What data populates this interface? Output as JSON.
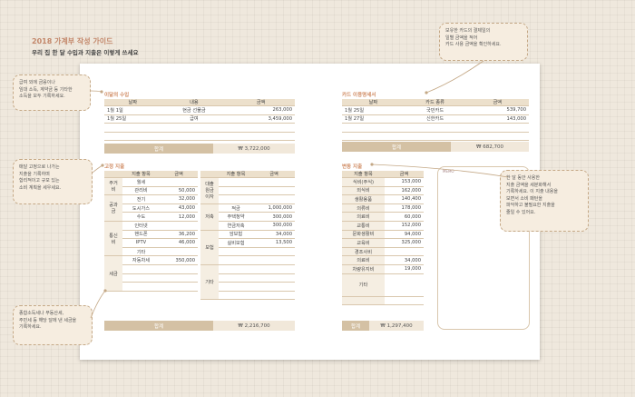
{
  "header": {
    "title": "2018 가계부 작성 가이드",
    "subtitle": "우리 집 한 달 수입과 지출은 이렇게 쓰세요"
  },
  "income": {
    "title": "이달의 수입",
    "headers": [
      "날짜",
      "내용",
      "금액"
    ],
    "rows": [
      {
        "date": "1월 1일",
        "desc": "현금 선물금",
        "amount": "263,000"
      },
      {
        "date": "1월 25일",
        "desc": "급여",
        "amount": "3,459,000"
      }
    ],
    "total_label": "합계",
    "total": "₩ 3,722,000"
  },
  "card": {
    "title": "카드 이용명세서",
    "headers": [
      "날짜",
      "카드 종류",
      "금액"
    ],
    "rows": [
      {
        "date": "1월 25일",
        "desc": "국민카드",
        "amount": "539,700"
      },
      {
        "date": "1월 27일",
        "desc": "신한카드",
        "amount": "143,000"
      }
    ],
    "total_label": "합계",
    "total": "₩ 682,700"
  },
  "fixed": {
    "title": "고정 지출",
    "headers": [
      "지출 항목",
      "금액",
      "지출 항목",
      "금액"
    ],
    "left_groups": [
      "주거비",
      "공과금",
      "통신비",
      "세금"
    ],
    "left_rows": [
      {
        "item": "월세",
        "amount": ""
      },
      {
        "item": "관리비",
        "amount": "50,000"
      },
      {
        "item": "전기",
        "amount": "32,000"
      },
      {
        "item": "도시가스",
        "amount": "43,000"
      },
      {
        "item": "수도",
        "amount": "12,000"
      },
      {
        "item": "인터넷",
        "amount": ""
      },
      {
        "item": "핸드폰",
        "amount": "36,200"
      },
      {
        "item": "IPTV",
        "amount": "46,000"
      },
      {
        "item": "기타",
        "amount": ""
      },
      {
        "item": "자동차세",
        "amount": "350,000"
      }
    ],
    "right_groups": [
      "대출원금 이자",
      "저축",
      "보험",
      "기타"
    ],
    "right_rows": [
      {
        "item": "",
        "amount": ""
      },
      {
        "item": "",
        "amount": ""
      },
      {
        "item": "",
        "amount": ""
      },
      {
        "item": "적금",
        "amount": "1,000,000"
      },
      {
        "item": "주택청약",
        "amount": "300,000"
      },
      {
        "item": "연금저축",
        "amount": "300,000"
      },
      {
        "item": "암보험",
        "amount": "34,000"
      },
      {
        "item": "실비보험",
        "amount": "13,500"
      }
    ],
    "total_label": "합계",
    "total": "₩ 2,216,700"
  },
  "variable": {
    "title": "변동 지출",
    "headers": [
      "지출 항목",
      "금액"
    ],
    "rows": [
      {
        "item": "식비(주식)",
        "amount": "153,000"
      },
      {
        "item": "외식비",
        "amount": "162,000"
      },
      {
        "item": "생활용품",
        "amount": "140,400"
      },
      {
        "item": "의류비",
        "amount": "178,000"
      },
      {
        "item": "의료비",
        "amount": "60,000"
      },
      {
        "item": "교통비",
        "amount": "152,000"
      },
      {
        "item": "문화생활비",
        "amount": "94,000"
      },
      {
        "item": "교육비",
        "amount": "325,000"
      },
      {
        "item": "경조사비",
        "amount": ""
      },
      {
        "item": "의료비",
        "amount": "34,000"
      },
      {
        "item": "차량유지비",
        "amount": "19,000"
      },
      {
        "item": "기타",
        "amount": ""
      }
    ],
    "total_label": "합계",
    "total": "₩ 1,297,400",
    "memo": "MEMO"
  },
  "notes": {
    "n1": "급여 외에 금융이나\n임대 소득, 계약금 등 기타한\n소득을 모두 기록하세요.",
    "n2": "보유한 카드의 결제일의\n일별 금액을 적어\n카드 사용 금액을 확인하세요.",
    "n3": "매달 고정으로 나가는\n지출을 기록하며\n합리적이고 규모 있는\n소비 계획을 세우세요.",
    "n4": "한 달 동안 사용한\n지출 금액을 세분화해서\n기록하세요. 이 지출 내용을\n보면서 소비 패턴을\n파악하고 불필요한 지출을\n줄일 수 있어요.",
    "n5": "종합소득세나 부동산세,\n주민세 등 해당 달에 낸 세금을\n기록하세요."
  }
}
